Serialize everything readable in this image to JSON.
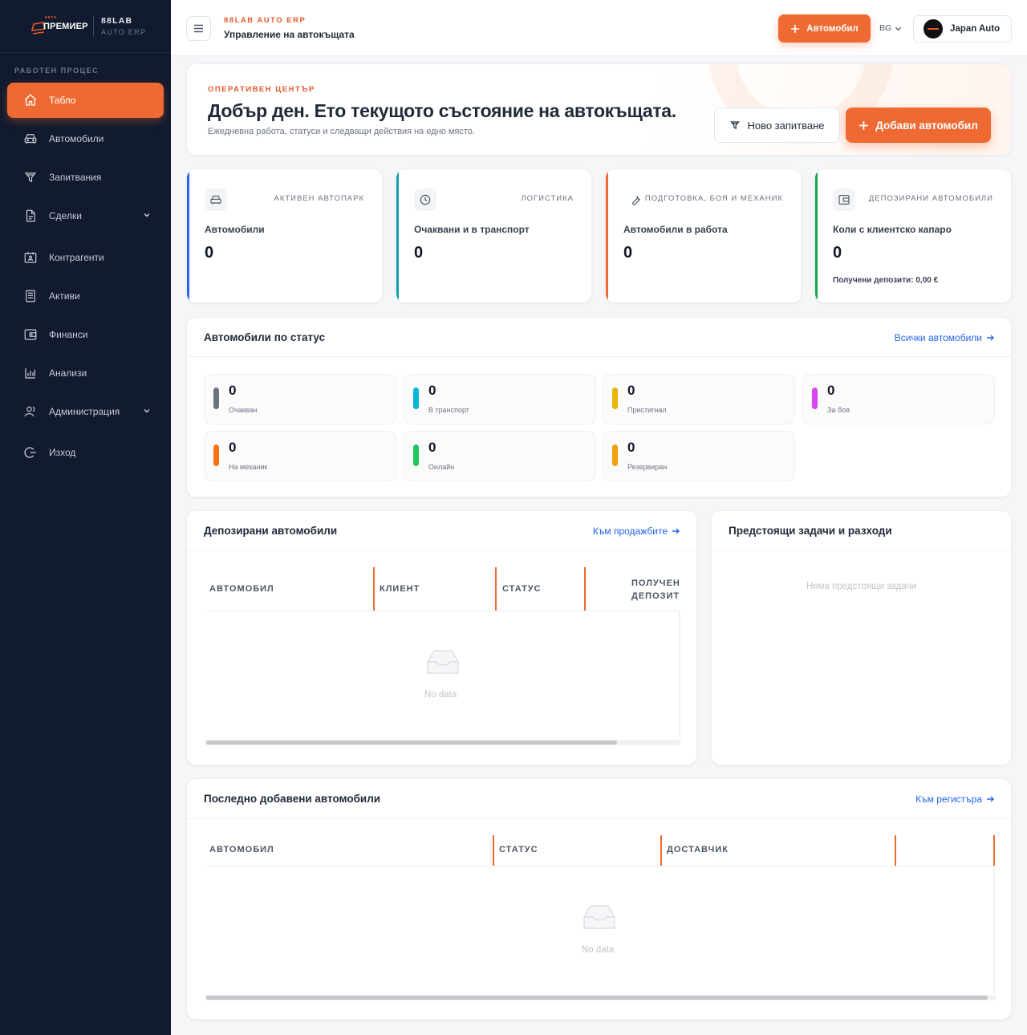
{
  "sidebar": {
    "logo_small": "авто",
    "logo_main": "ПРЕМИЕР",
    "brand_title": "88LAB",
    "brand_subtitle": "AUTO ERP",
    "section_title": "РАБОТЕН ПРОЦЕС",
    "items": [
      {
        "label": "Табло",
        "icon": "home-icon",
        "active": true
      },
      {
        "label": "Автомобили",
        "icon": "car-icon"
      },
      {
        "label": "Запитвания",
        "icon": "filter-icon"
      },
      {
        "label": "Сделки",
        "icon": "document-icon",
        "expandable": true
      },
      {
        "label": "Контрагенти",
        "icon": "contacts-icon"
      },
      {
        "label": "Активи",
        "icon": "building-icon"
      },
      {
        "label": "Финанси",
        "icon": "wallet-icon"
      },
      {
        "label": "Анализи",
        "icon": "bar-chart-icon"
      },
      {
        "label": "Администрация",
        "icon": "users-icon",
        "expandable": true
      },
      {
        "label": "Изход",
        "icon": "logout-icon"
      }
    ]
  },
  "topbar": {
    "eyebrow": "88LAB AUTO ERP",
    "title": "Управление на автокъщата",
    "add_car_label": "Автомобил",
    "language": "BG",
    "account_name": "Japan Auto"
  },
  "hero": {
    "eyebrow": "ОПЕРАТИВЕН ЦЕНТЪР",
    "title": "Добър ден. Ето текущото състояние на автокъщата.",
    "subtitle": "Ежедневна работа, статуси и следващи действия на едно място.",
    "new_inquiry_label": "Ново запитване",
    "add_car_label": "Добави автомобил"
  },
  "stats": [
    {
      "category": "АКТИВЕН АВТОПАРК",
      "label": "Автомобили",
      "value": "0",
      "icon": "car-icon",
      "color": "#2563eb"
    },
    {
      "category": "ЛОГИСТИКА",
      "label": "Очаквани и в транспорт",
      "value": "0",
      "icon": "clock-icon",
      "color": "#0e9fb5"
    },
    {
      "category": "ПОДГОТОВКА, БОЯ И МЕХАНИК",
      "label": "Автомобили в работа",
      "value": "0",
      "icon": "wrench-icon",
      "color": "#ee6a32"
    },
    {
      "category": "ДЕПОЗИРАНИ АВТОМОБИЛИ",
      "label": "Коли с клиентско капаро",
      "value": "0",
      "icon": "wallet-icon",
      "color": "#16a34a",
      "note": "Получени депозити: 0,00 €"
    }
  ],
  "status_section": {
    "title": "Автомобили по статус",
    "link": "Всички автомобили",
    "tiles": [
      {
        "count": "0",
        "label": "Очакван",
        "color": "#6b7280"
      },
      {
        "count": "0",
        "label": "В транспорт",
        "color": "#06b6d4"
      },
      {
        "count": "0",
        "label": "Пристигнал",
        "color": "#eab308"
      },
      {
        "count": "0",
        "label": "За боя",
        "color": "#d946ef"
      },
      {
        "count": "0",
        "label": "На механик",
        "color": "#f97316"
      },
      {
        "count": "0",
        "label": "Онлайн",
        "color": "#22c55e"
      },
      {
        "count": "0",
        "label": "Резервиран",
        "color": "#f59e0b"
      }
    ]
  },
  "deposits": {
    "title": "Депозирани автомобили",
    "link": "Към продажбите",
    "columns": [
      "АВТОМОБИЛ",
      "КЛИЕНТ",
      "СТАТУС",
      "ПОЛУЧЕНИ ДЕПОЗИТИ"
    ],
    "column_visible": [
      "ПОЛУЧЕН",
      "ДЕПОЗИТ"
    ],
    "empty_text": "No data"
  },
  "tasks": {
    "title": "Предстоящи задачи и разходи",
    "empty_text": "Няма предстоящи задачи"
  },
  "recent": {
    "title": "Последно добавени автомобили",
    "link": "Към регистъра",
    "columns": [
      "АВТОМОБИЛ",
      "СТАТУС",
      "ДОСТАВЧИК"
    ],
    "empty_text": "No data"
  }
}
